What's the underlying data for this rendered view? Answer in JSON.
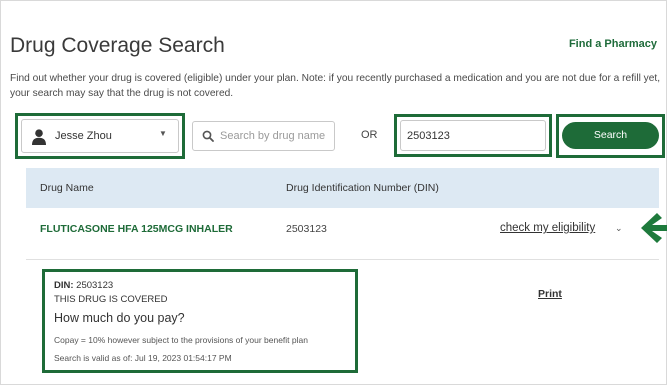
{
  "header": {
    "title": "Drug Coverage Search",
    "find_pharmacy": "Find a Pharmacy"
  },
  "description": "Find out whether your drug is covered (eligible) under your plan. Note: if you recently purchased a medication and you are not due for a refill yet, your search may say that the drug is not covered.",
  "search": {
    "member_name": "Jesse Zhou",
    "drug_name_placeholder": "Search by drug name",
    "drug_name_value": "",
    "or_label": "OR",
    "din_value": "2503123",
    "search_button": "Search"
  },
  "table": {
    "columns": [
      "Drug Name",
      "Drug Identification Number (DIN)"
    ],
    "rows": [
      {
        "drug_name": "FLUTICASONE HFA 125MCG INHALER",
        "din": "2503123",
        "action": "check my eligibility"
      }
    ]
  },
  "detail": {
    "din_label": "DIN:",
    "din_value": "2503123",
    "status": "THIS DRUG IS COVERED",
    "heading": "How much do you pay?",
    "copay": "Copay = 10% however subject to the provisions of your benefit plan",
    "valid_as_of": "Search is valid as of: Jul 19, 2023 01:54:17 PM",
    "print_label": "Print"
  },
  "colors": {
    "brand_green": "#1e6b38",
    "table_header_bg": "#dde9f3",
    "highlight_border": "#1e6b38"
  },
  "icons": [
    "person-icon",
    "chevron-down-icon",
    "search-icon",
    "arrow-left-icon"
  ]
}
